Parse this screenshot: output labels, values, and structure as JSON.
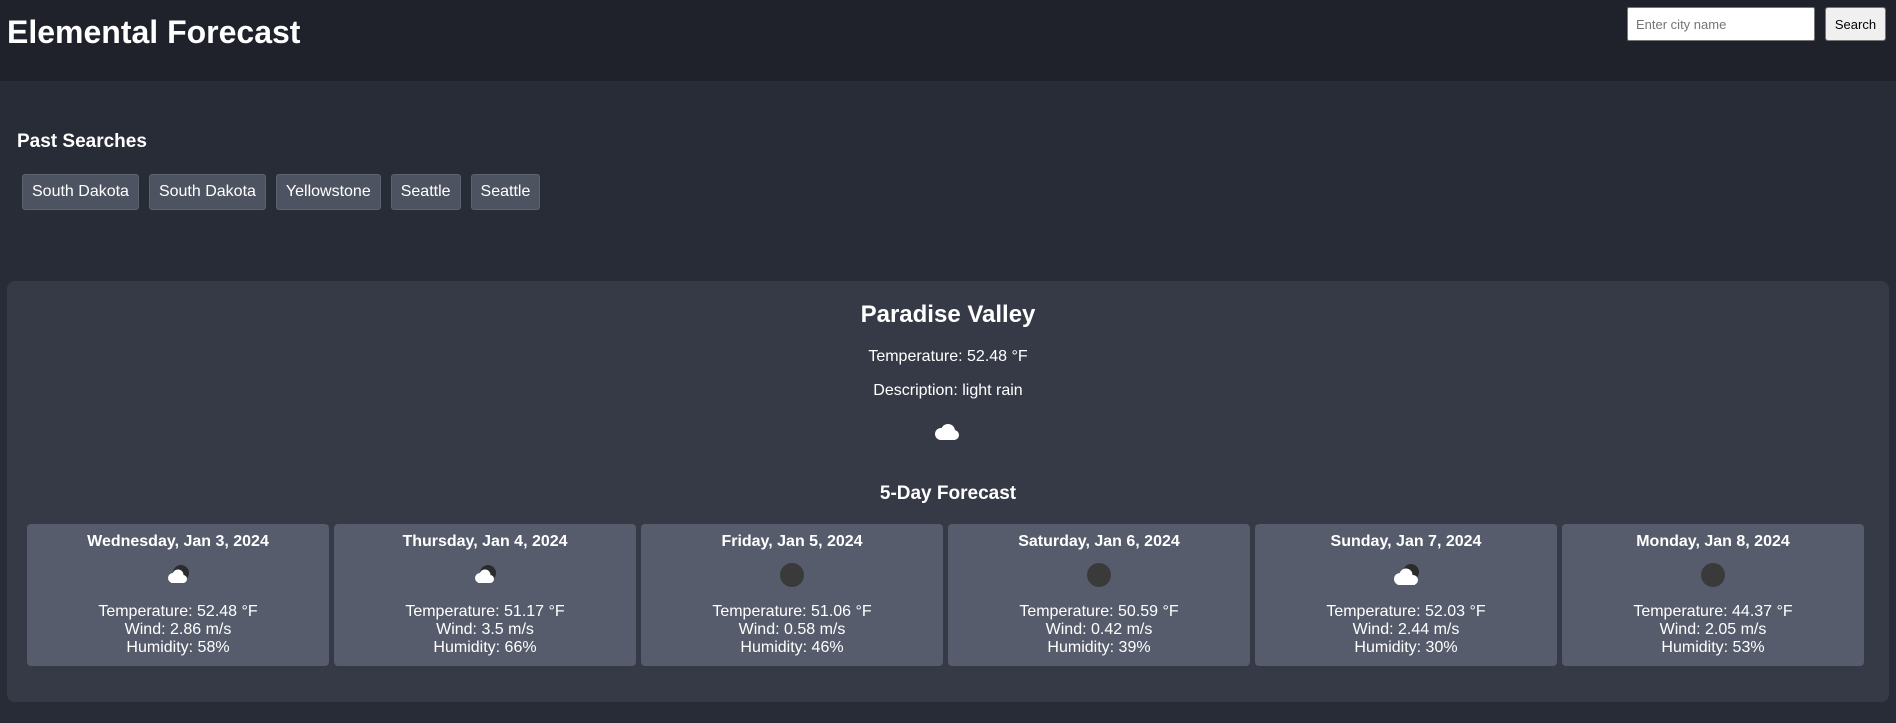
{
  "app": {
    "title": "Elemental Forecast"
  },
  "search": {
    "placeholder": "Enter city name",
    "value": "",
    "button_label": "Search"
  },
  "past_searches": {
    "title": "Past Searches",
    "items": [
      "South Dakota",
      "South Dakota",
      "Yellowstone",
      "Seattle",
      "Seattle"
    ]
  },
  "current": {
    "city": "Paradise Valley",
    "temperature": "Temperature: 52.48 °F",
    "description": "Description: light rain",
    "icon": "light-rain-cloud-icon"
  },
  "forecast": {
    "title": "5-Day Forecast",
    "days": [
      {
        "date": "Wednesday, Jan 3, 2024",
        "icon": "cloud-moon-icon",
        "temperature": "Temperature: 52.48 °F",
        "wind": "Wind: 2.86 m/s",
        "humidity": "Humidity: 58%"
      },
      {
        "date": "Thursday, Jan 4, 2024",
        "icon": "cloud-moon-icon",
        "temperature": "Temperature: 51.17 °F",
        "wind": "Wind: 3.5 m/s",
        "humidity": "Humidity: 66%"
      },
      {
        "date": "Friday, Jan 5, 2024",
        "icon": "clear-night-icon",
        "temperature": "Temperature: 51.06 °F",
        "wind": "Wind: 0.58 m/s",
        "humidity": "Humidity: 46%"
      },
      {
        "date": "Saturday, Jan 6, 2024",
        "icon": "clear-night-icon",
        "temperature": "Temperature: 50.59 °F",
        "wind": "Wind: 0.42 m/s",
        "humidity": "Humidity: 39%"
      },
      {
        "date": "Sunday, Jan 7, 2024",
        "icon": "cloud-moon-icon",
        "temperature": "Temperature: 52.03 °F",
        "wind": "Wind: 2.44 m/s",
        "humidity": "Humidity: 30%"
      },
      {
        "date": "Monday, Jan 8, 2024",
        "icon": "clear-night-icon",
        "temperature": "Temperature: 44.37 °F",
        "wind": "Wind: 2.05 m/s",
        "humidity": "Humidity: 53%"
      }
    ]
  },
  "colors": {
    "page_bg": "#282c36",
    "header_bg": "#1f222a",
    "panel_bg": "#363a46",
    "card_bg": "#565c6c",
    "past_button_bg": "#4e5361",
    "text": "#ffffff"
  }
}
